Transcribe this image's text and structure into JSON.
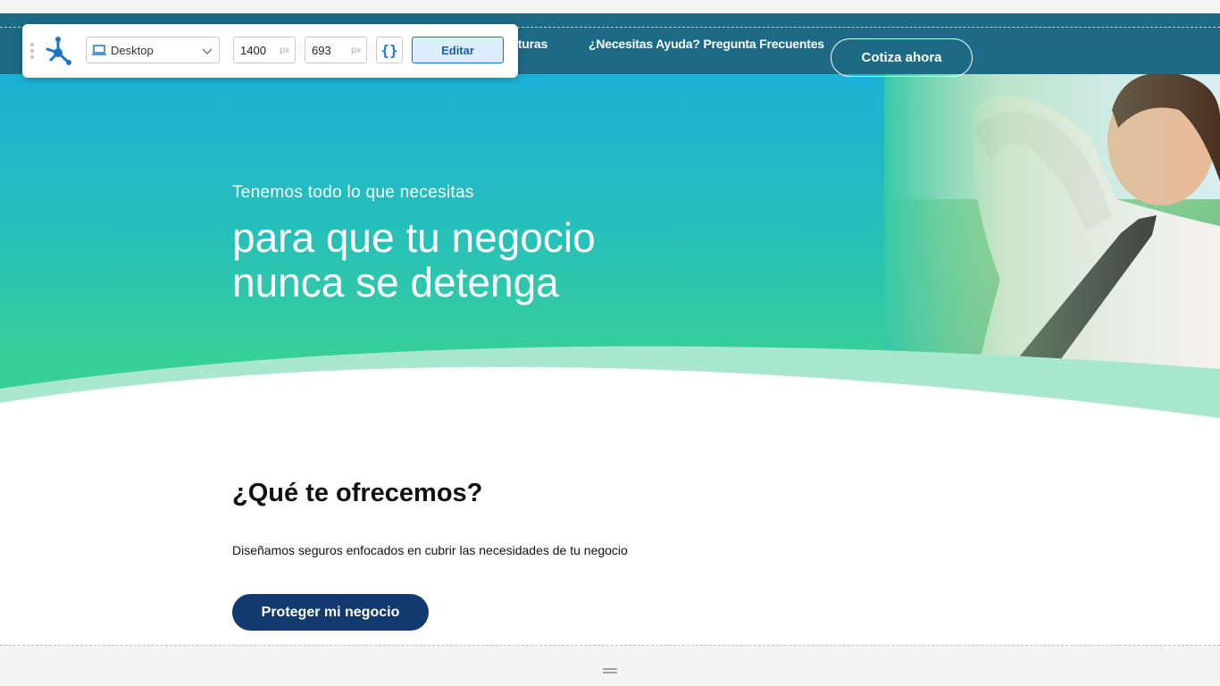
{
  "nav": {
    "partial_link": "erturas",
    "help_link": "¿Necesitas Ayuda? Pregunta Frecuentes",
    "cta": "Cotiza ahora"
  },
  "hero": {
    "subtitle": "Tenemos todo lo que necesitas",
    "title_line1": "para que tu negocio",
    "title_line2": "nunca se detenga"
  },
  "offers": {
    "title": "¿Qué te ofrecemos?",
    "description": "Diseñamos seguros enfocados en cubrir las necesidades de tu negocio",
    "button": "Proteger mi negocio"
  },
  "toolbar": {
    "device": "Desktop",
    "width_value": "1400",
    "height_value": "693",
    "unit": "px",
    "edit_label": "Editar",
    "code_glyph": "{}"
  },
  "colors": {
    "nav_bg": "#1d6a86",
    "hero_top": "#1cb1d7",
    "hero_bottom": "#3bd296",
    "button_dark": "#123a70",
    "editor_accent": "#1a73c8"
  }
}
